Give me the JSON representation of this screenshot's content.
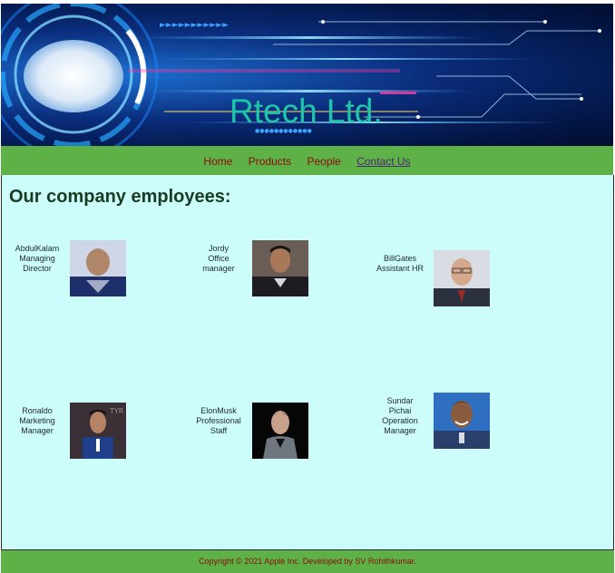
{
  "header": {
    "brand": "Rtech Ltd."
  },
  "nav": {
    "items": [
      {
        "label": "Home"
      },
      {
        "label": "Products"
      },
      {
        "label": "People"
      },
      {
        "label": "Contact Us"
      }
    ]
  },
  "main": {
    "heading": "Our company employees:",
    "employees": [
      {
        "lines": [
          "AbdulKalam",
          "Managing",
          "Director"
        ]
      },
      {
        "lines": [
          "Jordy",
          "Office",
          "manager"
        ]
      },
      {
        "lines": [
          "BillGates",
          "Assistant HR"
        ]
      },
      {
        "lines": [
          "Ronaldo",
          "Marketing",
          "Manager"
        ]
      },
      {
        "lines": [
          "ElonMusk",
          "Professional",
          "Staff"
        ]
      },
      {
        "lines": [
          "Sundar",
          "Pichai",
          "Operation",
          "Manager"
        ]
      }
    ]
  },
  "footer": {
    "copyright": "Copyright © 2021 Apple Inc. Developed by SV Rohithkumar."
  },
  "colors": {
    "nav_bg": "#5db146",
    "main_bg": "#ccfdfb",
    "brand": "#1ec6a9",
    "link": "#8b0d0d"
  }
}
